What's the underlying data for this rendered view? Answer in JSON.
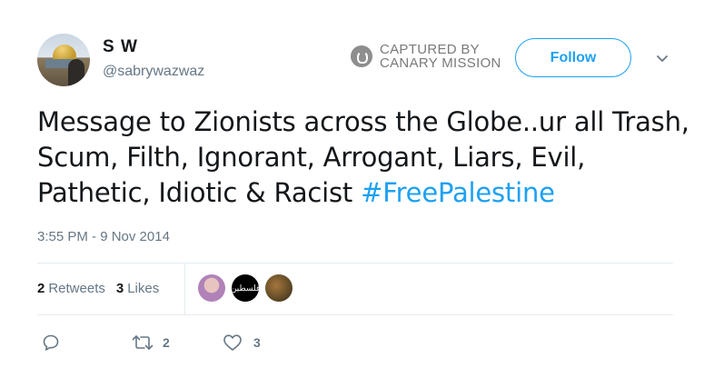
{
  "user": {
    "name": "S W",
    "handle": "@sabrywazwaz"
  },
  "captured": {
    "line1": "CAPTURED BY",
    "line2": "CANARY MISSION"
  },
  "follow_label": "Follow",
  "tweet": {
    "text": "Message to Zionists across the Globe..ur all Trash, Scum, Filth, Ignorant, Arrogant, Liars, Evil, Pathetic, Idiotic & Racist ",
    "hashtag": "#FreePalestine",
    "timestamp": "3:55 PM - 9 Nov 2014"
  },
  "stats": {
    "retweets_count": "2",
    "retweets_label": "Retweets",
    "likes_count": "3",
    "likes_label": "Likes"
  },
  "likers": {
    "second_label": "فلسطين"
  },
  "actions": {
    "retweet_count": "2",
    "like_count": "3"
  },
  "colors": {
    "accent": "#1da1f2",
    "muted": "#657786",
    "divider": "#e6ecf0"
  }
}
